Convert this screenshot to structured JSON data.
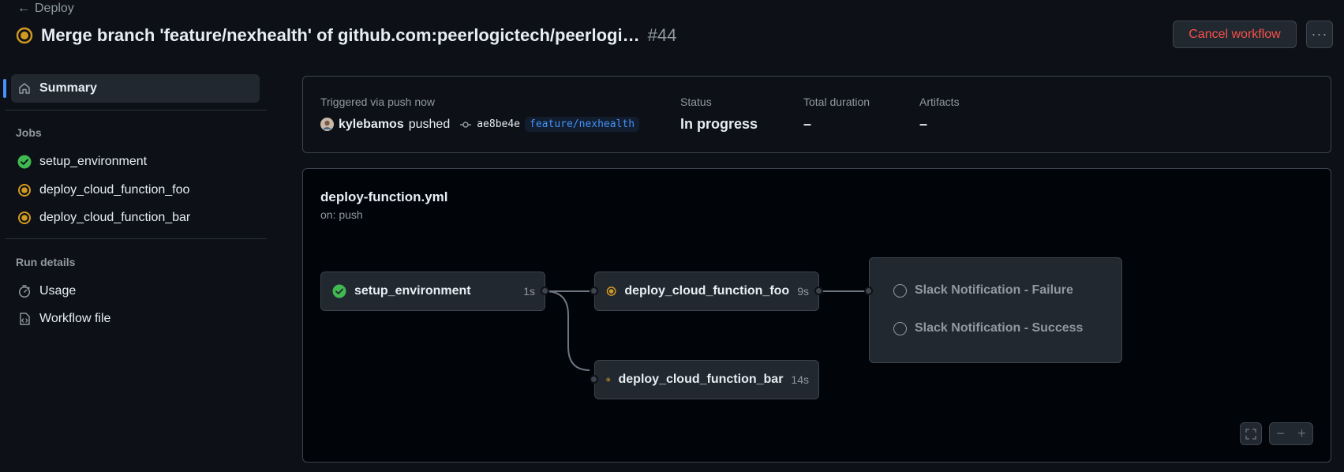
{
  "header": {
    "back_label": "Deploy",
    "title": "Merge branch 'feature/nexhealth' of github.com:peerlogictech/peerlogi…",
    "run_number": "#44",
    "cancel_label": "Cancel workflow",
    "more_label": "···"
  },
  "sidebar": {
    "summary_label": "Summary",
    "jobs_heading": "Jobs",
    "jobs": [
      {
        "label": "setup_environment",
        "status": "success"
      },
      {
        "label": "deploy_cloud_function_foo",
        "status": "in_progress"
      },
      {
        "label": "deploy_cloud_function_bar",
        "status": "in_progress"
      }
    ],
    "run_details_heading": "Run details",
    "details": [
      {
        "label": "Usage",
        "icon": "stopwatch-icon"
      },
      {
        "label": "Workflow file",
        "icon": "file-code-icon"
      }
    ]
  },
  "summary": {
    "trigger_label": "Triggered via push now",
    "actor": "kylebamos",
    "action": "pushed",
    "commit": "ae8be4e",
    "branch": "feature/nexhealth",
    "status_label": "Status",
    "status_value": "In progress",
    "duration_label": "Total duration",
    "duration_value": "–",
    "artifacts_label": "Artifacts",
    "artifacts_value": "–"
  },
  "graph": {
    "workflow_file": "deploy-function.yml",
    "trigger": "on: push",
    "jobs": [
      {
        "name": "setup_environment",
        "duration": "1s",
        "status": "success"
      },
      {
        "name": "deploy_cloud_function_foo",
        "duration": "9s",
        "status": "in_progress"
      },
      {
        "name": "deploy_cloud_function_bar",
        "duration": "14s",
        "status": "in_progress"
      }
    ],
    "pending_jobs": [
      "Slack Notification - Failure",
      "Slack Notification - Success"
    ]
  },
  "colors": {
    "background": "#0d1117",
    "success": "#3fb950",
    "in_progress": "#d29922",
    "danger": "#f85149",
    "accent": "#4493f8"
  }
}
